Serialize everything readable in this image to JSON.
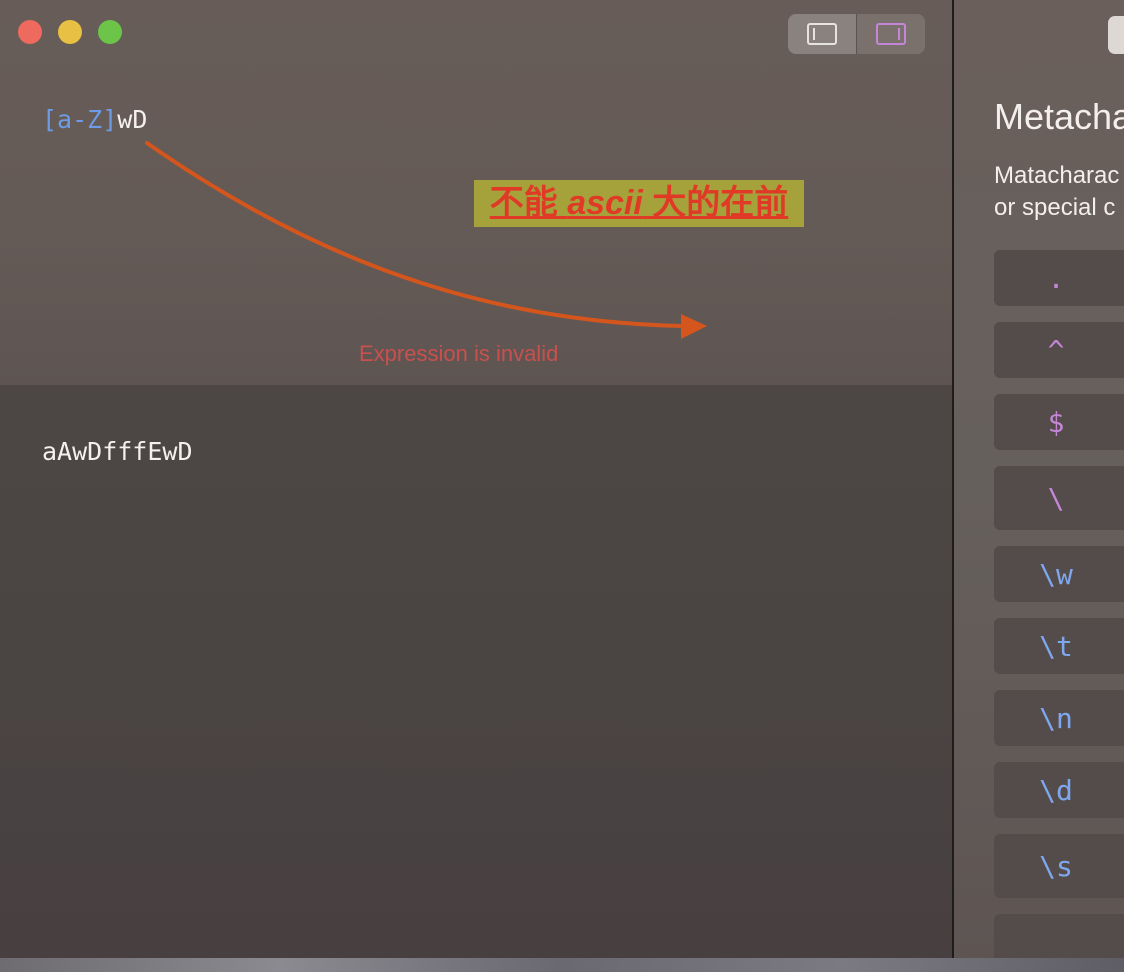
{
  "window": {
    "controls": [
      "close",
      "minimize",
      "maximize"
    ],
    "toolbar": {
      "buttons": [
        {
          "icon": "left-panel-icon",
          "state": "inactive"
        },
        {
          "icon": "right-panel-icon",
          "state": "active"
        }
      ]
    }
  },
  "editor": {
    "expression": {
      "class_part": "[a-Z]",
      "rest_part": "wD"
    },
    "error_message": "Expression is invalid",
    "annotation": {
      "prefix": "不能 ",
      "italic": "ascii",
      "suffix": " 大的在前"
    },
    "test_string": "aAwDfffEwD"
  },
  "reference": {
    "title": "Metacha",
    "description_line1": "Matacharac",
    "description_line2": "or special c",
    "tokens": [
      {
        "label": ".",
        "color": "#c586d8"
      },
      {
        "label": "^",
        "color": "#c586d8"
      },
      {
        "label": "$",
        "color": "#c586d8"
      },
      {
        "label": "\\",
        "color": "#c586d8"
      },
      {
        "label": "\\w",
        "color": "#7ea7ee"
      },
      {
        "label": "\\t",
        "color": "#7ea7ee"
      },
      {
        "label": "\\n",
        "color": "#7ea7ee"
      },
      {
        "label": "\\d",
        "color": "#7ea7ee"
      },
      {
        "label": "\\s",
        "color": "#7ea7ee"
      },
      {
        "label": "",
        "color": "#7ea7ee"
      }
    ]
  },
  "colors": {
    "class_token": "#6e9be6",
    "error": "#c9504e",
    "annotation_bg": "#a6a23b",
    "annotation_text": "#e03a27",
    "arrow": "#d4561d"
  }
}
